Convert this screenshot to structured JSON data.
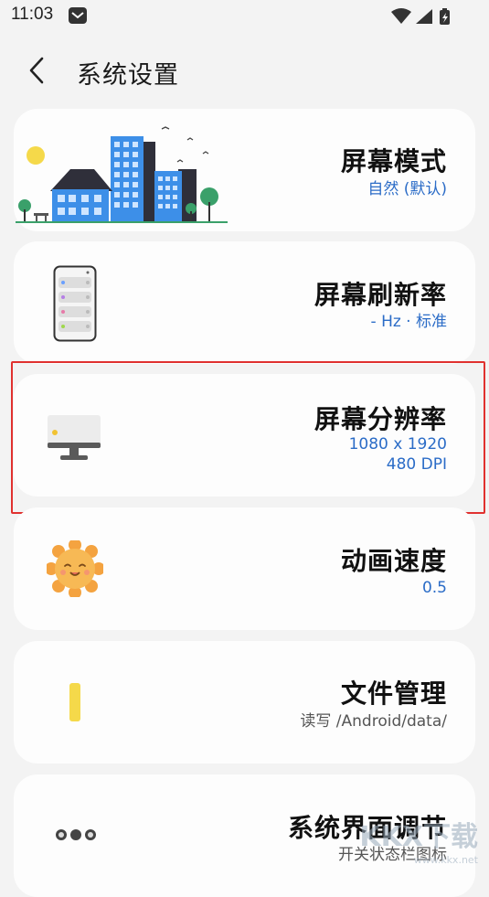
{
  "status_bar": {
    "time": "11:03",
    "icons": [
      "mail-icon",
      "wifi-icon",
      "signal-icon",
      "battery-charging-icon"
    ]
  },
  "header": {
    "back_icon": "chevron-left-icon",
    "title": "系统设置"
  },
  "settings": [
    {
      "title": "屏幕模式",
      "sub1": "自然 (默认)",
      "sub2": "",
      "icon": "city-illustration-icon"
    },
    {
      "title": "屏幕刷新率",
      "sub1": "- Hz · 标准",
      "sub2": "",
      "icon": "phone-list-icon"
    },
    {
      "title": "屏幕分辨率",
      "sub1": "1080 x 1920",
      "sub2": "480 DPI",
      "icon": "monitor-icon"
    },
    {
      "title": "动画速度",
      "sub1": "0.5",
      "sub2": "",
      "icon": "smiling-sun-icon"
    },
    {
      "title": "文件管理",
      "sub1": "读写 /Android/data/",
      "sub2": "",
      "icon": "yellow-bar-icon"
    },
    {
      "title": "系统界面调节",
      "sub1": "开关状态栏图标",
      "sub2": "",
      "icon": "three-dots-icon"
    }
  ],
  "watermark": {
    "text": "KKX下载",
    "url": "www.kkx.net"
  },
  "colors": {
    "background": "#f3f3f3",
    "card": "#fdfdfd",
    "accent_blue": "#2b6cc7",
    "highlight_red": "#e0312f"
  }
}
